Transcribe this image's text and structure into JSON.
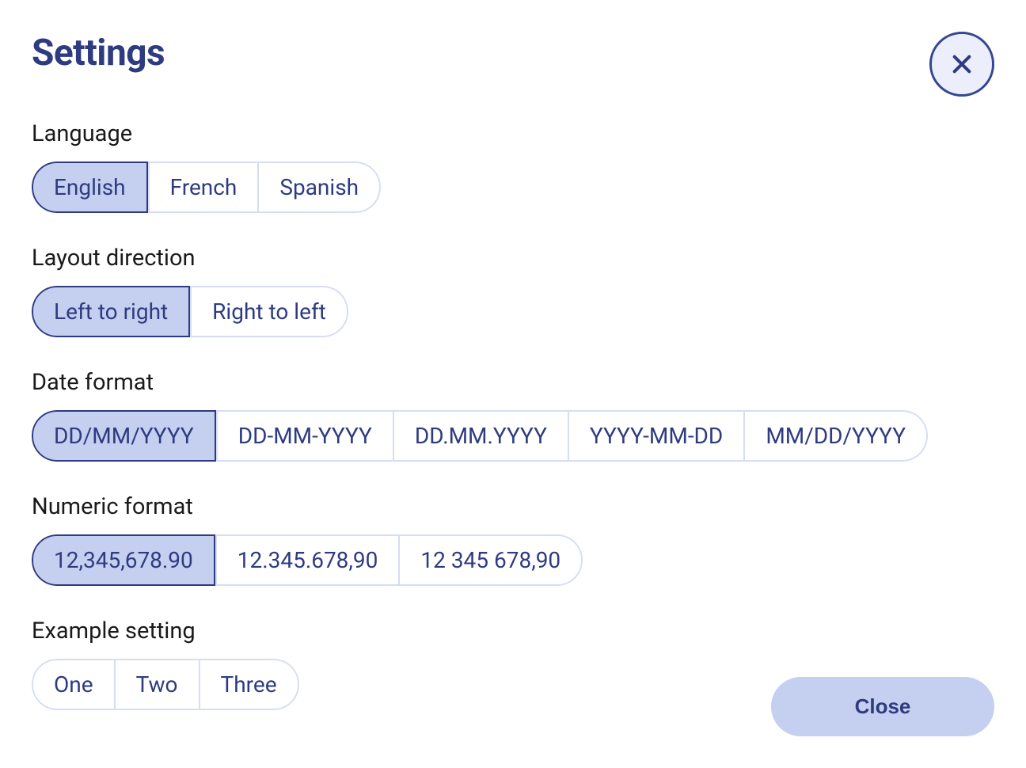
{
  "title": "Settings",
  "closeButton": "Close",
  "groups": [
    {
      "label": "Language",
      "options": [
        "English",
        "French",
        "Spanish"
      ],
      "selected": 0
    },
    {
      "label": "Layout direction",
      "options": [
        "Left to right",
        "Right to left"
      ],
      "selected": 0
    },
    {
      "label": "Date format",
      "options": [
        "DD/MM/YYYY",
        "DD-MM-YYYY",
        "DD.MM.YYYY",
        "YYYY-MM-DD",
        "MM/DD/YYYY"
      ],
      "selected": 0
    },
    {
      "label": "Numeric format",
      "options": [
        "12,345,678.90",
        "12.345.678,90",
        "12 345 678,90"
      ],
      "selected": 0
    },
    {
      "label": "Example setting",
      "options": [
        "One",
        "Two",
        "Three"
      ],
      "selected": -1
    }
  ]
}
